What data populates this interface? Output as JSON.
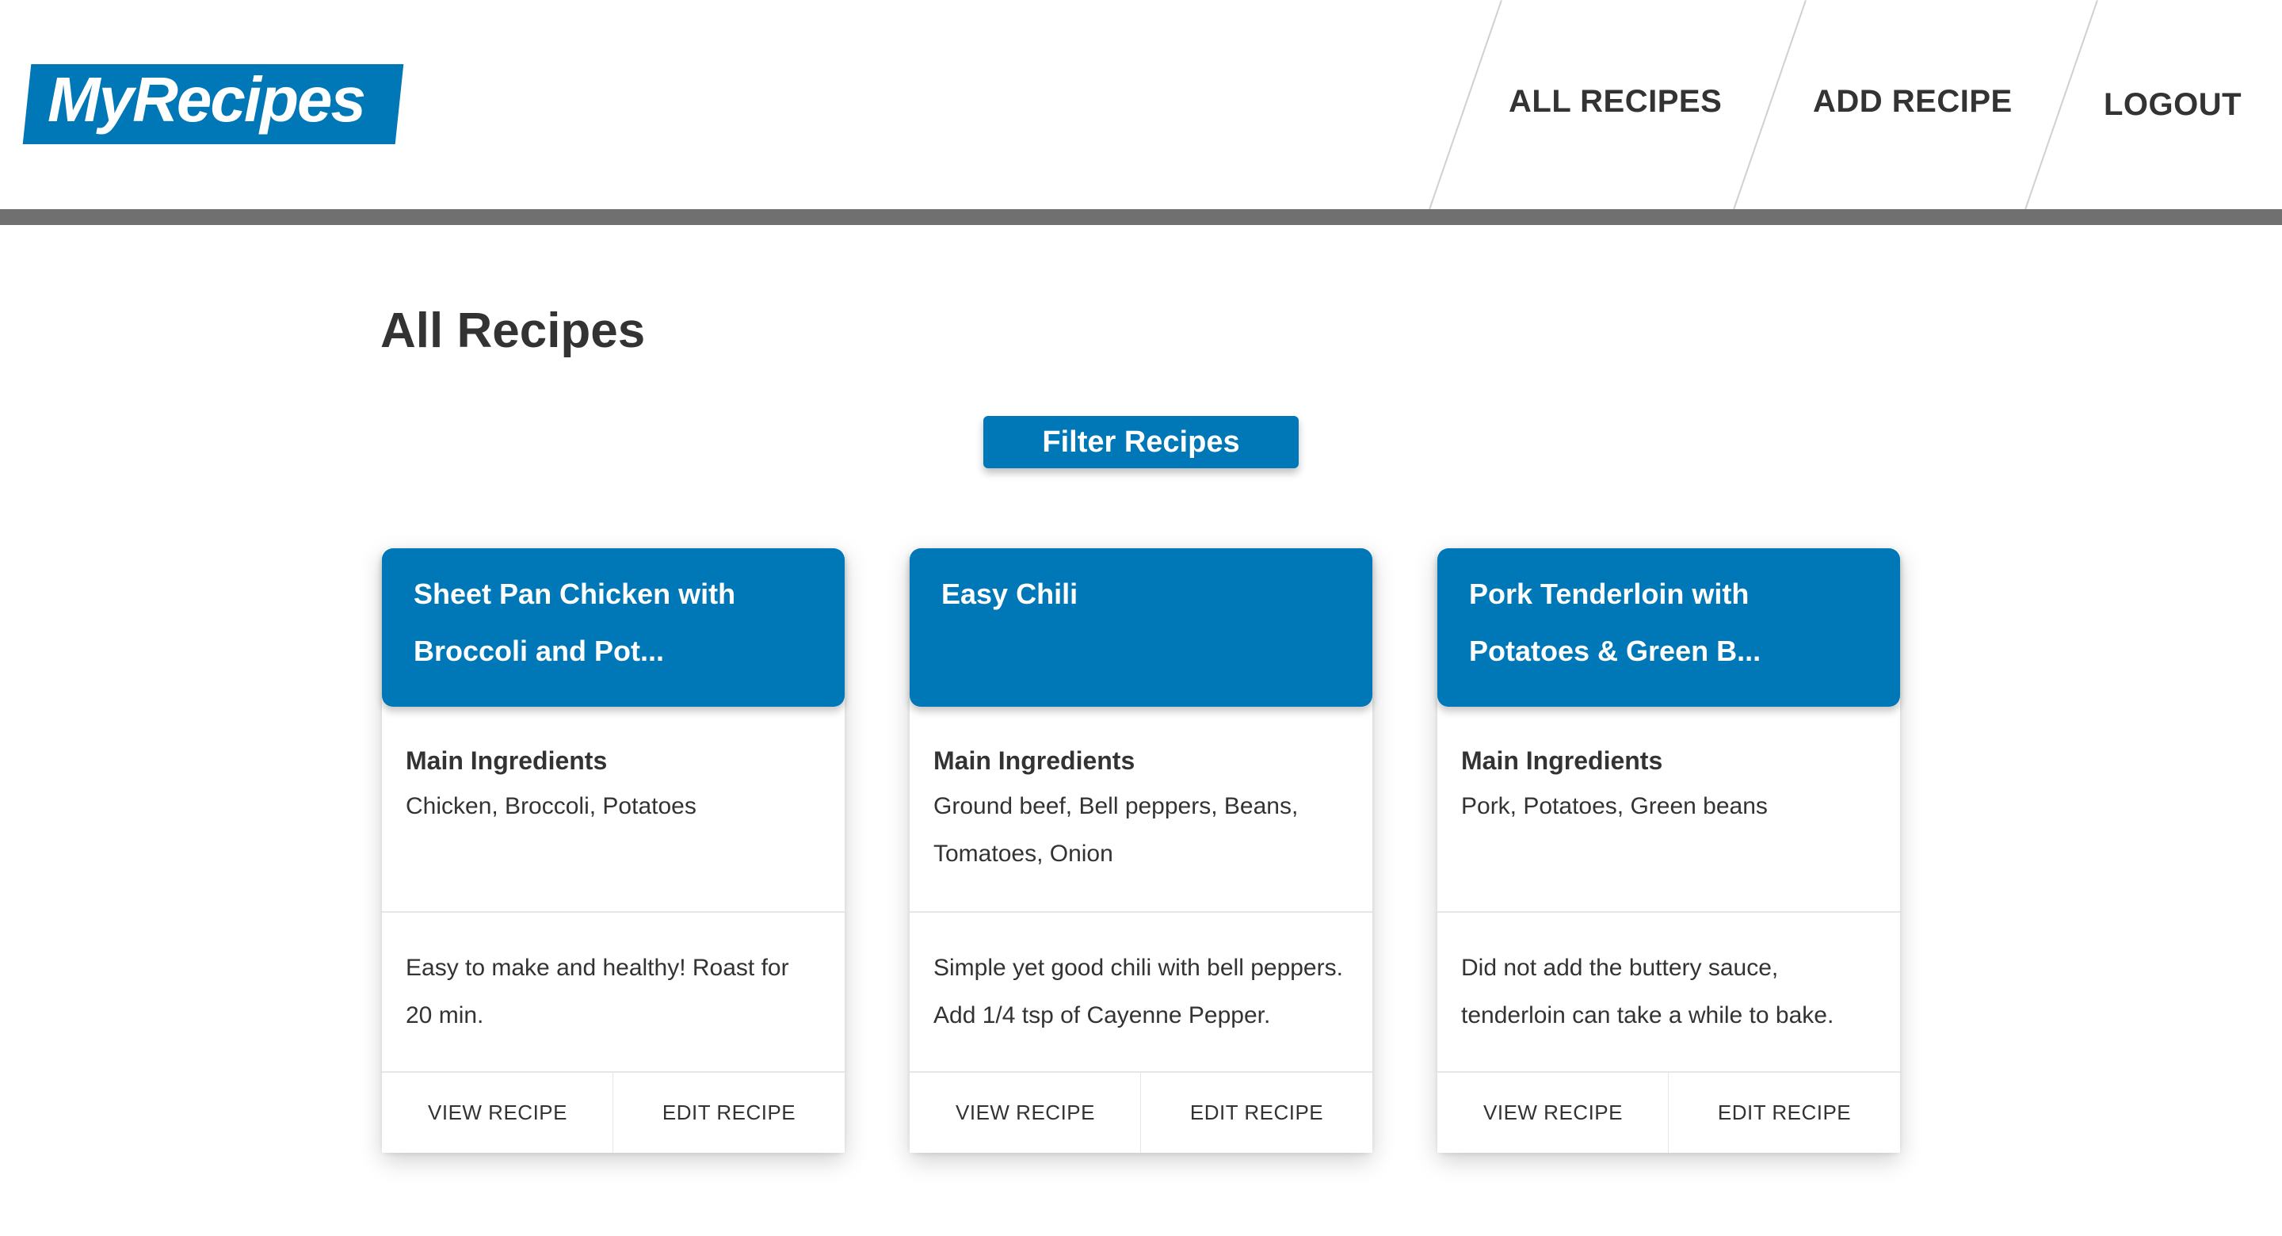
{
  "header": {
    "logo_text": "MyRecipes",
    "nav": [
      {
        "label": "ALL RECIPES"
      },
      {
        "label": "ADD RECIPE"
      },
      {
        "label": "LOGOUT"
      }
    ],
    "colors": {
      "brand": "#0077b6",
      "header_bar": "#707070"
    }
  },
  "main": {
    "page_title": "All Recipes",
    "filter_button_label": "Filter Recipes",
    "cards": [
      {
        "title_line1": "Sheet Pan Chicken with",
        "title_line2": "Broccoli and Pot...",
        "ingredients_heading": "Main Ingredients",
        "ingredients_line1": "Chicken, Broccoli, Potatoes",
        "ingredients_line2": "",
        "note_line1": "Easy to make and healthy! Roast for",
        "note_line2": "20 min.",
        "view_label": "VIEW RECIPE",
        "edit_label": "EDIT RECIPE"
      },
      {
        "title_line1": "Easy Chili",
        "title_line2": "",
        "ingredients_heading": "Main Ingredients",
        "ingredients_line1": "Ground beef, Bell peppers, Beans,",
        "ingredients_line2": "Tomatoes, Onion",
        "note_line1": "Simple yet good chili with bell peppers.",
        "note_line2": "Add 1/4 tsp of Cayenne Pepper.",
        "view_label": "VIEW RECIPE",
        "edit_label": "EDIT RECIPE"
      },
      {
        "title_line1": "Pork Tenderloin with",
        "title_line2": "Potatoes & Green B...",
        "ingredients_heading": "Main Ingredients",
        "ingredients_line1": "Pork, Potatoes, Green beans",
        "ingredients_line2": "",
        "note_line1": "Did not add the buttery sauce,",
        "note_line2": "tenderloin can take a while to bake.",
        "view_label": "VIEW RECIPE",
        "edit_label": "EDIT RECIPE"
      }
    ]
  }
}
